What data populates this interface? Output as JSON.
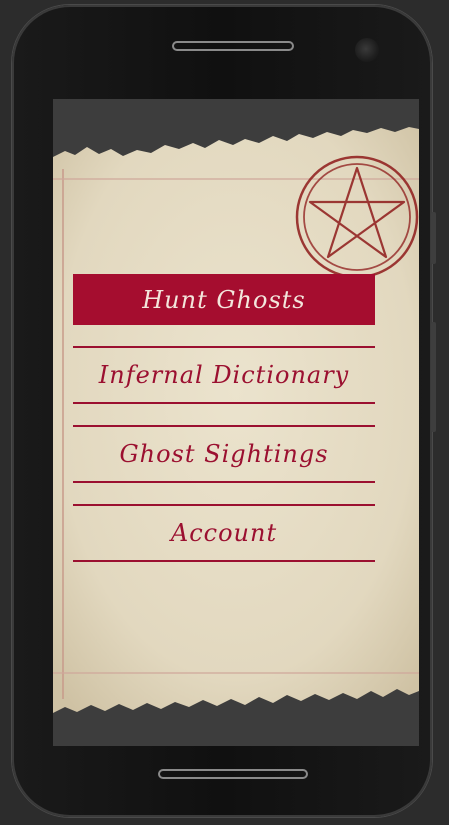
{
  "menu": {
    "items": [
      {
        "label": "Hunt Ghosts",
        "active": true
      },
      {
        "label": "Infernal Dictionary",
        "active": false
      },
      {
        "label": "Ghost Sightings",
        "active": false
      },
      {
        "label": "Account",
        "active": false
      }
    ]
  },
  "colors": {
    "accent": "#a50d2f",
    "paper": "#e6dcc4",
    "text_active": "#f3e6dc"
  },
  "icons": {
    "emblem": "pentagram-icon"
  }
}
